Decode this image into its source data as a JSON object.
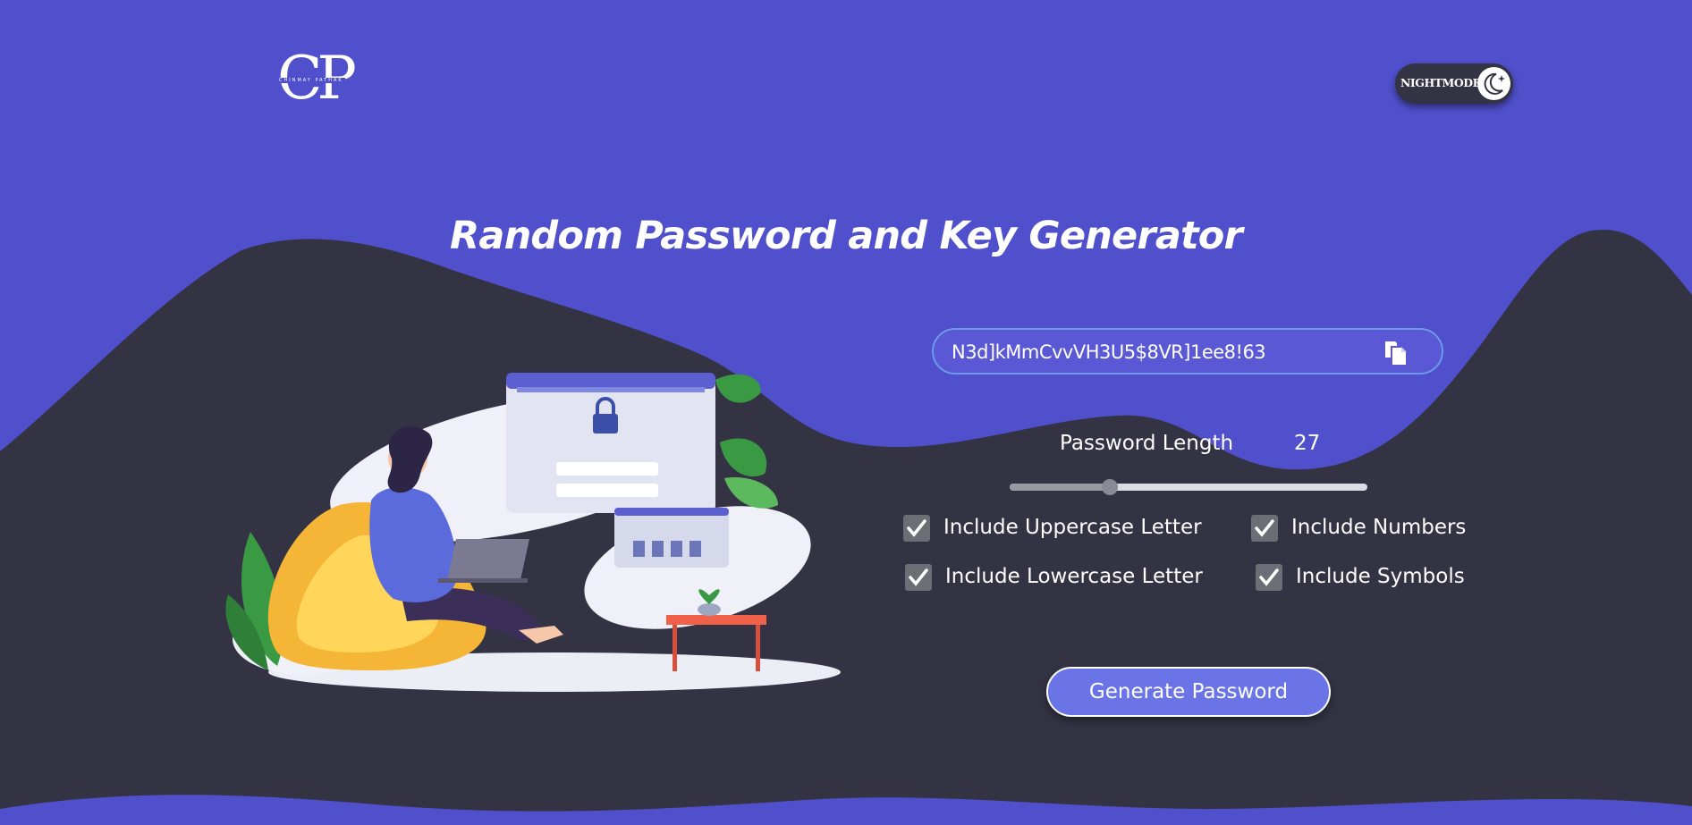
{
  "header": {
    "logo_text": "CP",
    "logo_tagline": "CHINMAY PATHAK",
    "nightmode_label": "NIGHTMODE",
    "nightmode_icon": "moon-stars-icon"
  },
  "main": {
    "title": "Random Password and Key Generator",
    "password": {
      "value": "N3d]kMmCvvVH3U5$8VR]1ee8!63",
      "copy_icon": "copy-icon"
    },
    "length": {
      "label": "Password Length",
      "value": "27",
      "slider_fraction": 0.28
    },
    "options": [
      {
        "label": "Include Uppercase Letter",
        "checked": true
      },
      {
        "label": "Include Numbers",
        "checked": true
      },
      {
        "label": "Include Lowercase Letter",
        "checked": true
      },
      {
        "label": "Include Symbols",
        "checked": true
      }
    ],
    "generate_label": "Generate Password"
  },
  "colors": {
    "background": "#5050cc",
    "wave": "#333344",
    "accent": "#6a74e6",
    "field_border": "#6d9ae8"
  }
}
